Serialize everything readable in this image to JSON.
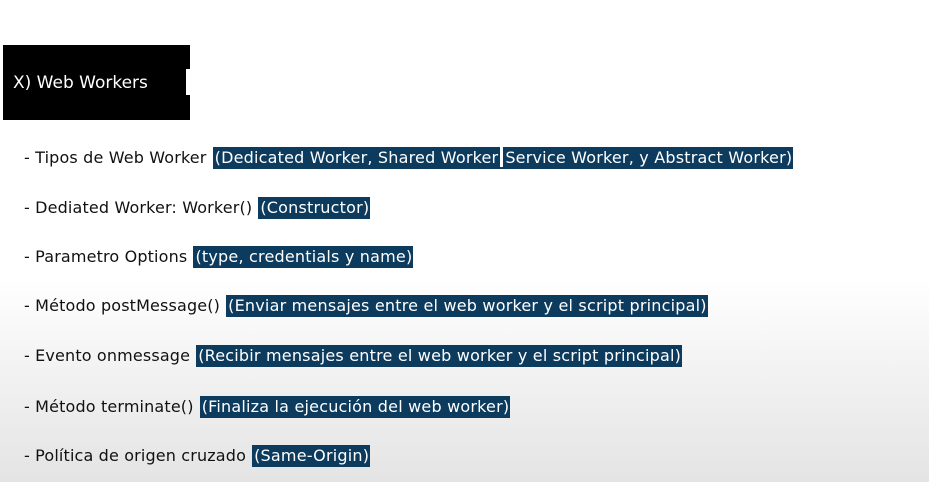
{
  "title": "X) Web Workers",
  "bullets": [
    {
      "lead": "- Tipos de Web Worker",
      "highlight_part1": "(Dedicated Worker, Shared Worker",
      "highlight_part2": "Service Worker, y Abstract Worker)"
    },
    {
      "lead": "- Dediated Worker: Worker()",
      "highlight": "(Constructor)"
    },
    {
      "lead": "- Parametro Options",
      "highlight": "(type, credentials y name)"
    },
    {
      "lead": "- Método postMessage()",
      "highlight": "(Enviar mensajes entre el web worker y el script principal)"
    },
    {
      "lead": "- Evento onmessage",
      "highlight": "(Recibir mensajes entre el web worker y el script principal)"
    },
    {
      "lead": "- Método terminate()",
      "highlight": "(Finaliza la ejecución del web worker)"
    },
    {
      "lead": "- Política de origen cruzado",
      "highlight": "(Same-Origin)"
    }
  ],
  "colors": {
    "highlight_bg": "#0d3b5e",
    "title_bg": "#000000"
  }
}
